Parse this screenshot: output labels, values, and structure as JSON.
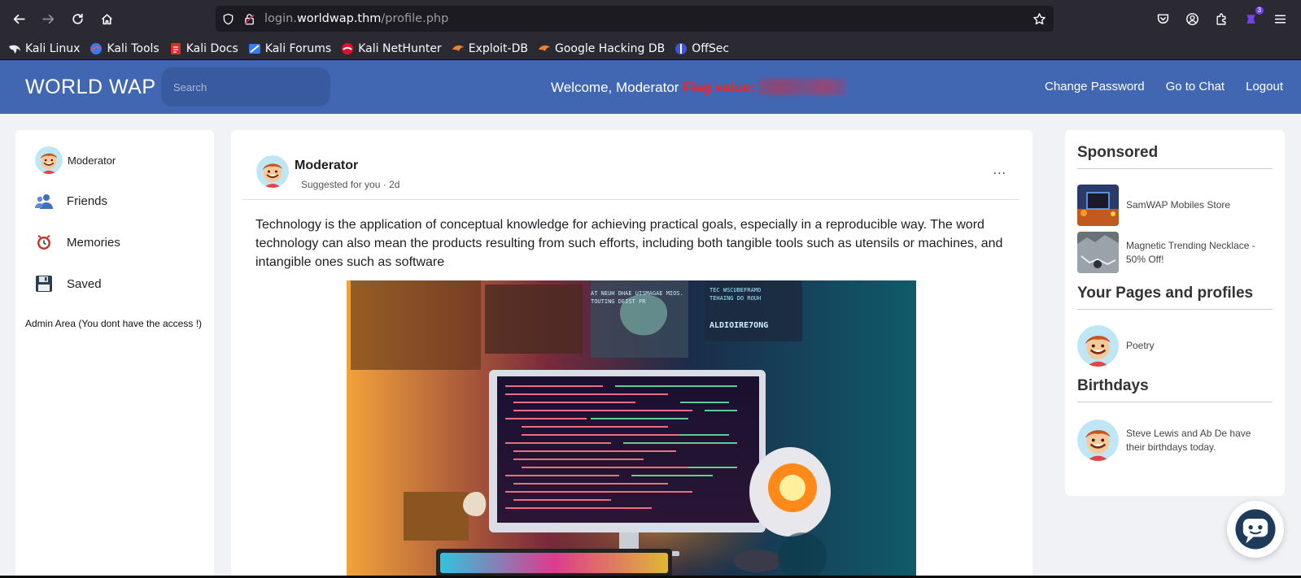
{
  "browser": {
    "url_prefix": "login.",
    "url_host": "worldwap.thm",
    "url_path": "/profile.php",
    "extension_badge": "3",
    "bookmarks": [
      {
        "label": "Kali Linux",
        "icon": "kali-dragon-icon"
      },
      {
        "label": "Kali Tools",
        "icon": "kali-tools-icon"
      },
      {
        "label": "Kali Docs",
        "icon": "kali-docs-icon"
      },
      {
        "label": "Kali Forums",
        "icon": "kali-forums-icon"
      },
      {
        "label": "Kali NetHunter",
        "icon": "nethunter-icon"
      },
      {
        "label": "Exploit-DB",
        "icon": "exploit-db-icon"
      },
      {
        "label": "Google Hacking DB",
        "icon": "ghdb-icon"
      },
      {
        "label": "OffSec",
        "icon": "offsec-icon"
      }
    ]
  },
  "header": {
    "logo": "WORLD WAP",
    "search_placeholder": "Search",
    "welcome": "Welcome, Moderator ",
    "flag_label": "Flag value:",
    "links": {
      "change_password": "Change Password",
      "go_to_chat": "Go to Chat",
      "logout": "Logout"
    }
  },
  "sidebar": {
    "profile_name": "Moderator",
    "items": [
      {
        "label": "Friends",
        "icon": "friends-icon"
      },
      {
        "label": "Memories",
        "icon": "memories-icon"
      },
      {
        "label": "Saved",
        "icon": "floppy-disk-icon"
      }
    ],
    "admin_note": "Admin Area (You dont have the access !)"
  },
  "post": {
    "author": "Moderator",
    "meta": "Suggested for you · 2d",
    "menu": "...",
    "text": "Technology is the application of conceptual knowledge for achieving practical goals, especially in a reproducible way. The word technology can also mean the products resulting from such efforts, including both tangible tools such as utensils or machines, and intangible ones such as software",
    "image_screen_lines": [
      "AT NEUH DHAE UISMAGAE MIOS.",
      "TOUTING DEIST FR",
      "TEC WSCUBEFRAMO",
      "TEHAING DO ROUH",
      "ALDIOIRE7ONG"
    ]
  },
  "right_sidebar": {
    "sponsored_title": "Sponsored",
    "sponsored": [
      {
        "label": "SamWAP Mobiles Store"
      },
      {
        "label": "Magnetic Trending Necklace - 50% Off!"
      }
    ],
    "pages_title": "Your Pages and profiles",
    "pages": [
      {
        "label": "Poetry"
      }
    ],
    "birthdays_title": "Birthdays",
    "birthdays": [
      {
        "label": "Steve Lewis and Ab De have their birthdays today."
      }
    ]
  },
  "colors": {
    "header_blue": "#4267b2",
    "flag_red": "#ff1f1f",
    "page_bg": "#f0f2f5",
    "browser_chrome": "#2b2a33"
  }
}
